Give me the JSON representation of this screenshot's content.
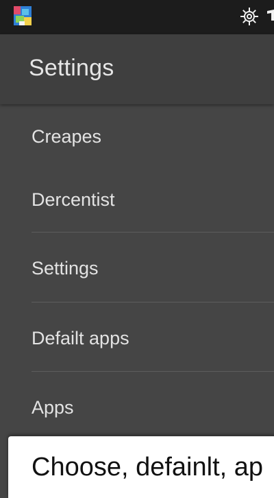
{
  "status_bar": {
    "app_icon": "app-icon",
    "settings_icon": "gear-icon"
  },
  "app_bar": {
    "title": "Settings"
  },
  "list": {
    "items": [
      {
        "label": "Creapes"
      },
      {
        "label": "Dercentist"
      },
      {
        "label": "Settings"
      },
      {
        "label": "Defailt apps"
      },
      {
        "label": "Apps"
      }
    ]
  },
  "bottom_sheet": {
    "text": "Choose, defainlt, ap"
  },
  "colors": {
    "status_bar": "#1c1c1c",
    "app_bar": "#3f3f3f",
    "background": "#454545",
    "text": "#e3e3e3",
    "divider": "#5d5d5d",
    "sheet": "#ffffff"
  }
}
